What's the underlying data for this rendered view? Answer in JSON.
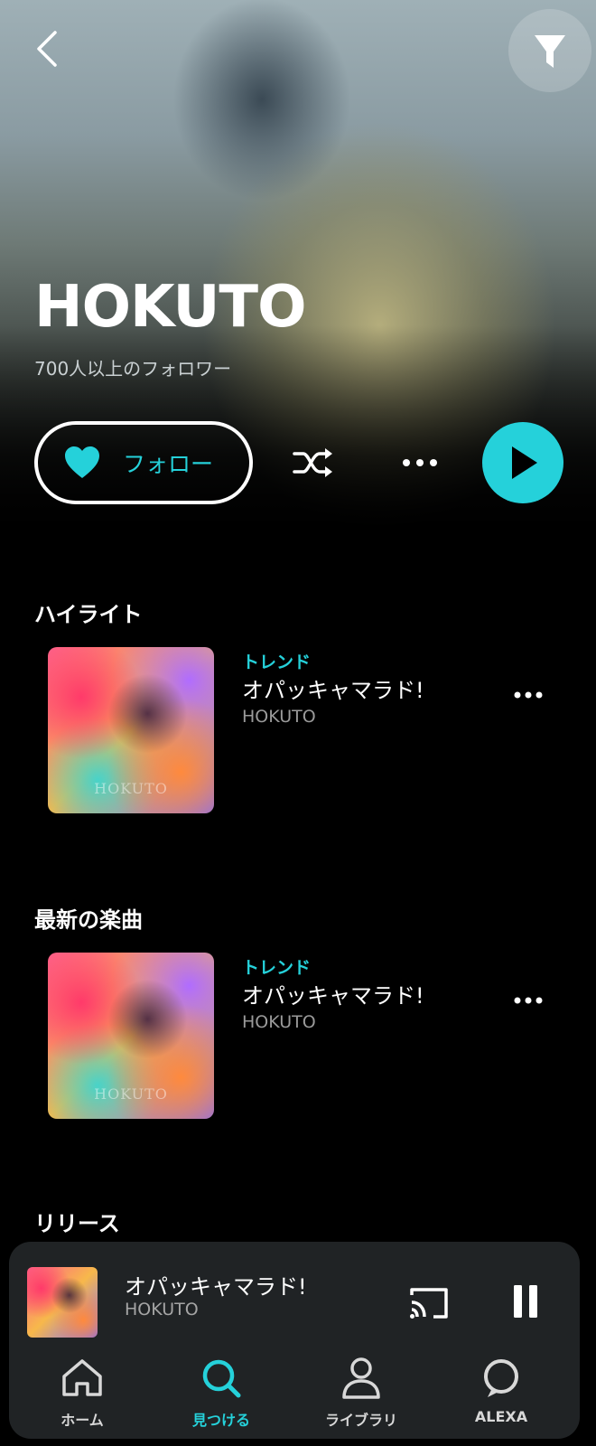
{
  "hero": {
    "artist_name": "HOKUTO",
    "followers": "700人以上のフォロワー",
    "follow_label": "フォロー"
  },
  "sections": {
    "highlight_title": "ハイライト",
    "latest_title": "最新の楽曲",
    "release_title": "リリース"
  },
  "highlight_track": {
    "badge": "トレンド",
    "title": "オパッキャマラド!",
    "artist": "HOKUTO",
    "cover_text": "HOKUTO"
  },
  "latest_track": {
    "badge": "トレンド",
    "title": "オパッキャマラド!",
    "artist": "HOKUTO",
    "cover_text": "HOKUTO"
  },
  "now_playing": {
    "title": "オパッキャマラド!",
    "artist": "HOKUTO"
  },
  "tabs": [
    {
      "label": "ホーム",
      "icon": "home-icon"
    },
    {
      "label": "見つける",
      "icon": "search-icon"
    },
    {
      "label": "ライブラリ",
      "icon": "person-icon"
    },
    {
      "label": "ALEXA",
      "icon": "alexa-icon"
    }
  ],
  "colors": {
    "accent": "#25d1da",
    "background": "#000000",
    "mini_player": "#202325"
  }
}
